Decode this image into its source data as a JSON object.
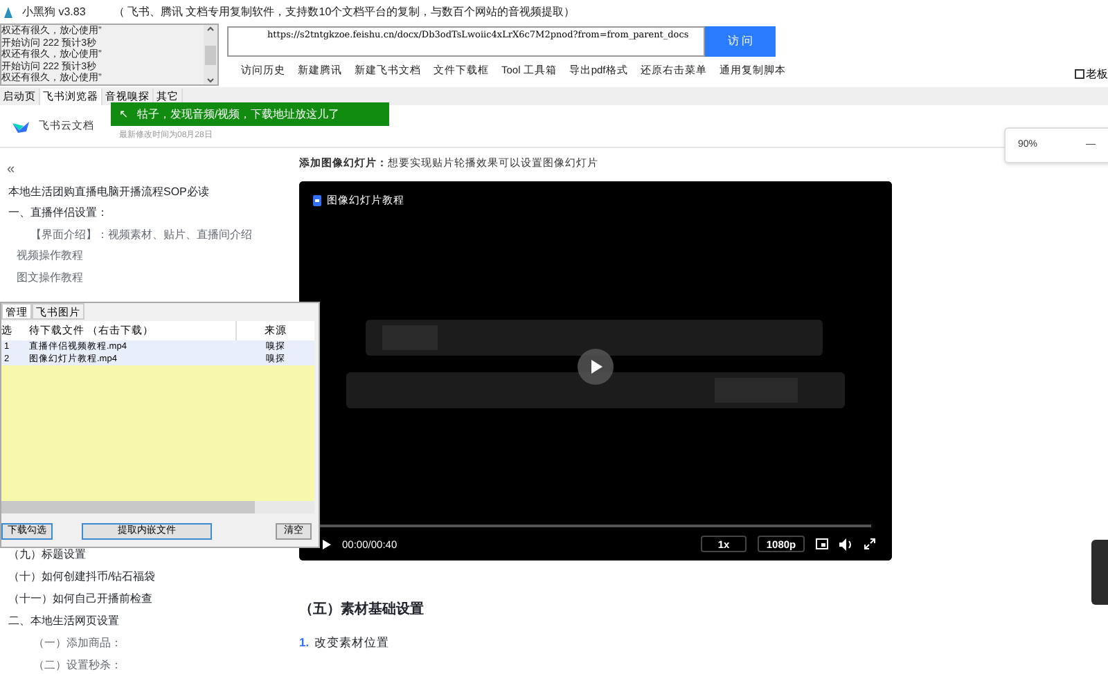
{
  "window": {
    "title": "小黑狗 v3.83",
    "subtitle": "（ 飞书、腾讯 文档专用复制软件，支持数10个文档平台的复制，与数百个网站的音视频提取）"
  },
  "log": [
    "权还有很久，放心使用”",
    "开始访问 222 预计3秒",
    "权还有很久，放心使用”",
    "开始访问 222 预计3秒",
    "权还有很久，放心使用”"
  ],
  "url_field": {
    "value": "https://s2tntgkzoe.feishu.cn/docx/Db3odTsLwoiic4xLrX6c7M2pnod?from=from_parent_docs"
  },
  "visit_button": "访 问",
  "boss_checkbox": {
    "label": "老板",
    "checked": false
  },
  "toolbar": [
    "访问历史",
    "新建腾讯",
    "新建飞书文档",
    "文件下载框",
    "Tool 工具箱",
    "导出pdf格式",
    "还原右击菜单",
    "通用复制脚本"
  ],
  "tabs": [
    {
      "label": "启动页",
      "selected": false
    },
    {
      "label": "飞书浏览器",
      "selected": true
    },
    {
      "label": "音视嗅探",
      "selected": false
    },
    {
      "label": "其它",
      "selected": false
    }
  ],
  "doc_header": {
    "brand": "飞书云文档",
    "modified": "最新修改时间为08月28日"
  },
  "toast": {
    "icon": "↖",
    "text": "牯子，发现音频/视频，下载地址放这儿了"
  },
  "zoom_popup": {
    "value": "90%",
    "minus": "—"
  },
  "outline": {
    "collapse": "«",
    "items": [
      {
        "text": "本地生活团购直播电脑开播流程SOP必读"
      },
      {
        "text": "一、直播伴侣设置：",
        "children": [
          {
            "text": "【界面介绍】：视频素材、贴片、直播间介绍",
            "children": [
              {
                "text": "视频操作教程"
              },
              {
                "text": "图文操作教程"
              }
            ]
          }
        ]
      }
    ],
    "items_below": [
      {
        "text": "（九）标题设置"
      },
      {
        "text": "（十）如何创建抖币/钻石福袋"
      },
      {
        "text": "（十一）如何自己开播前检查"
      },
      {
        "text": "二、本地生活网页设置",
        "children": [
          {
            "text": "（一）添加商品："
          },
          {
            "text": "（二）设置秒杀："
          }
        ]
      }
    ]
  },
  "article": {
    "intro": "**添加图像幻灯片：**想要实现贴片轮播效果可以设置图像幻灯片",
    "video": {
      "title": "图像幻灯片教程",
      "time": "00:00/00:40",
      "speed": "1x",
      "quality": "1080p",
      "level": 0
    },
    "heading": "（五）素材基础设置",
    "step_number": "1.",
    "step": "改变素材位置"
  },
  "download_panel": {
    "tabs": [
      {
        "label": "管理",
        "selected": true
      },
      {
        "label": "飞书图片",
        "selected": false
      }
    ],
    "columns": [
      "选",
      "待下载文件 （右击下载）",
      "来源"
    ],
    "rows": [
      {
        "index": "1",
        "file": "直播伴侣视频教程.mp4",
        "source": "嗅探"
      },
      {
        "index": "2",
        "file": "图像幻灯片教程.mp4",
        "source": "嗅探"
      }
    ],
    "buttons": [
      "下载勾选",
      "提取内嵌文件",
      "清空"
    ]
  }
}
